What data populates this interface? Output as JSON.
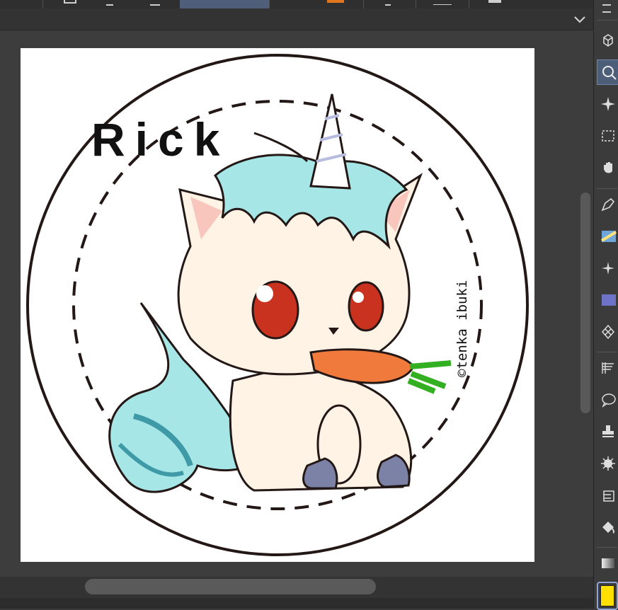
{
  "artwork": {
    "name_text": "Rick",
    "credit_text": "©tenka ibuki",
    "colors": {
      "mane": "#a6e6e6",
      "mane_dark": "#3f9aa8",
      "body": "#fff3e6",
      "blush": "#f8c6bd",
      "eye": "#c8321e",
      "carrot": "#f07a3c",
      "carrot_top": "#33b022",
      "hoof": "#7c82a6",
      "outline": "#231815"
    }
  },
  "tools": [
    {
      "icon": "3d-cube-icon",
      "active": false
    },
    {
      "icon": "zoom-icon",
      "active": true
    },
    {
      "icon": "auto-select-icon",
      "active": false
    },
    {
      "icon": "selection-icon",
      "active": false
    },
    {
      "icon": "hand-icon",
      "active": false
    },
    {
      "icon": "pen-icon",
      "active": false
    },
    {
      "icon": "brush-icon",
      "active": false
    },
    {
      "icon": "sparkle-icon",
      "active": false
    },
    {
      "icon": "airbrush-icon",
      "active": false
    },
    {
      "icon": "decoration-icon",
      "active": false
    },
    {
      "icon": "hatching-icon",
      "active": false
    },
    {
      "icon": "balloon-icon",
      "active": false
    },
    {
      "icon": "stamp-icon",
      "active": false
    },
    {
      "icon": "burst-icon",
      "active": false
    },
    {
      "icon": "ruler-icon",
      "active": false
    },
    {
      "icon": "fill-icon",
      "active": false
    },
    {
      "icon": "gradient-icon",
      "active": false
    }
  ],
  "current_color": "#ffe000"
}
